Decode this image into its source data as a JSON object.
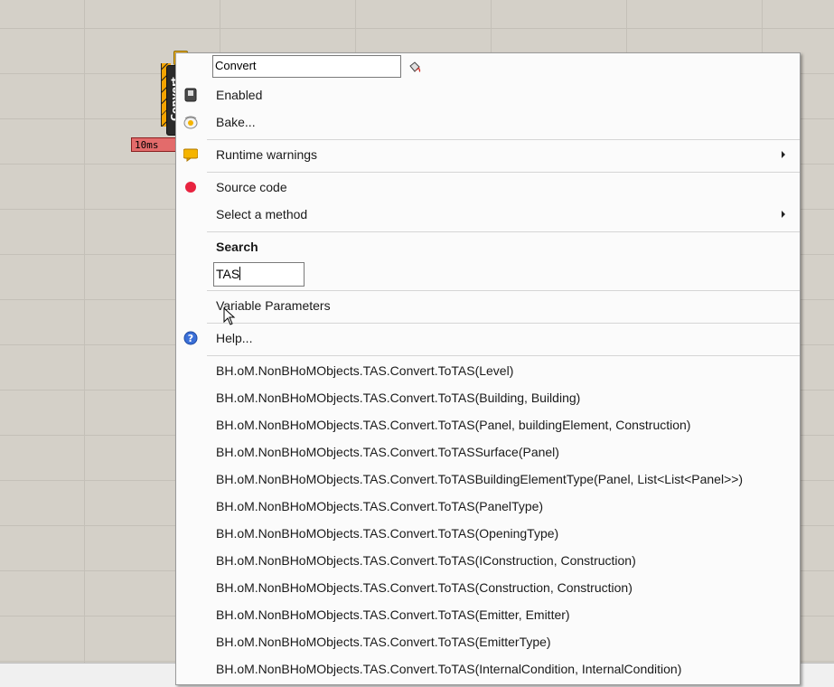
{
  "component": {
    "label": "Convert",
    "timer": "10ms"
  },
  "menu": {
    "name_value": "Convert",
    "enabled_label": "Enabled",
    "bake_label": "Bake...",
    "runtime_warnings_label": "Runtime warnings",
    "source_code_label": "Source code",
    "select_method_label": "Select a method",
    "search_heading": "Search",
    "search_value": "TAS",
    "variable_params_label": "Variable Parameters",
    "help_label": "Help...",
    "methods": [
      "BH.oM.NonBHoMObjects.TAS.Convert.ToTAS(Level)",
      "BH.oM.NonBHoMObjects.TAS.Convert.ToTAS(Building, Building)",
      "BH.oM.NonBHoMObjects.TAS.Convert.ToTAS(Panel, buildingElement, Construction)",
      "BH.oM.NonBHoMObjects.TAS.Convert.ToTASSurface(Panel)",
      "BH.oM.NonBHoMObjects.TAS.Convert.ToTASBuildingElementType(Panel, List<List<Panel>>)",
      "BH.oM.NonBHoMObjects.TAS.Convert.ToTAS(PanelType)",
      "BH.oM.NonBHoMObjects.TAS.Convert.ToTAS(OpeningType)",
      "BH.oM.NonBHoMObjects.TAS.Convert.ToTAS(IConstruction, Construction)",
      "BH.oM.NonBHoMObjects.TAS.Convert.ToTAS(Construction, Construction)",
      "BH.oM.NonBHoMObjects.TAS.Convert.ToTAS(Emitter, Emitter)",
      "BH.oM.NonBHoMObjects.TAS.Convert.ToTAS(EmitterType)",
      "BH.oM.NonBHoMObjects.TAS.Convert.ToTAS(InternalCondition, InternalCondition)"
    ]
  },
  "icons": {
    "enabled": "enabled-toggle-icon",
    "bake": "bake-egg-icon",
    "runtime_warnings": "warning-balloon-icon",
    "source_code": "red-dot-icon",
    "help": "help-question-icon",
    "paint": "paint-bucket-icon",
    "submenu": "chevron-right-icon"
  },
  "colors": {
    "timer_bg": "#e36b6b",
    "component_orange": "#f5a400",
    "source_dot": "#e8233f",
    "help_blue": "#3a6fd8"
  }
}
